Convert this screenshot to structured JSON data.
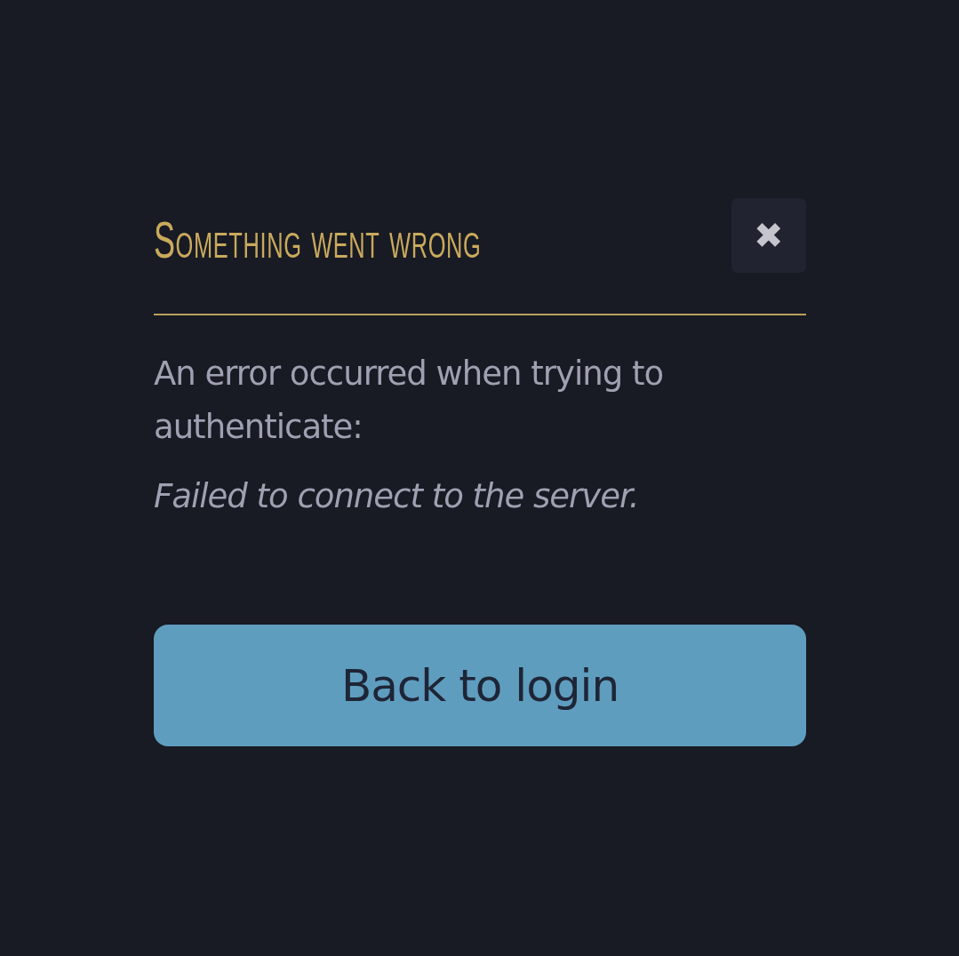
{
  "dialog": {
    "title": "Something went wrong",
    "close_button": {
      "label": "✖"
    },
    "message": "An error occurred when trying to authenticate:",
    "error_detail": "Failed to connect to the server.",
    "button": {
      "label": "Back to login"
    }
  }
}
